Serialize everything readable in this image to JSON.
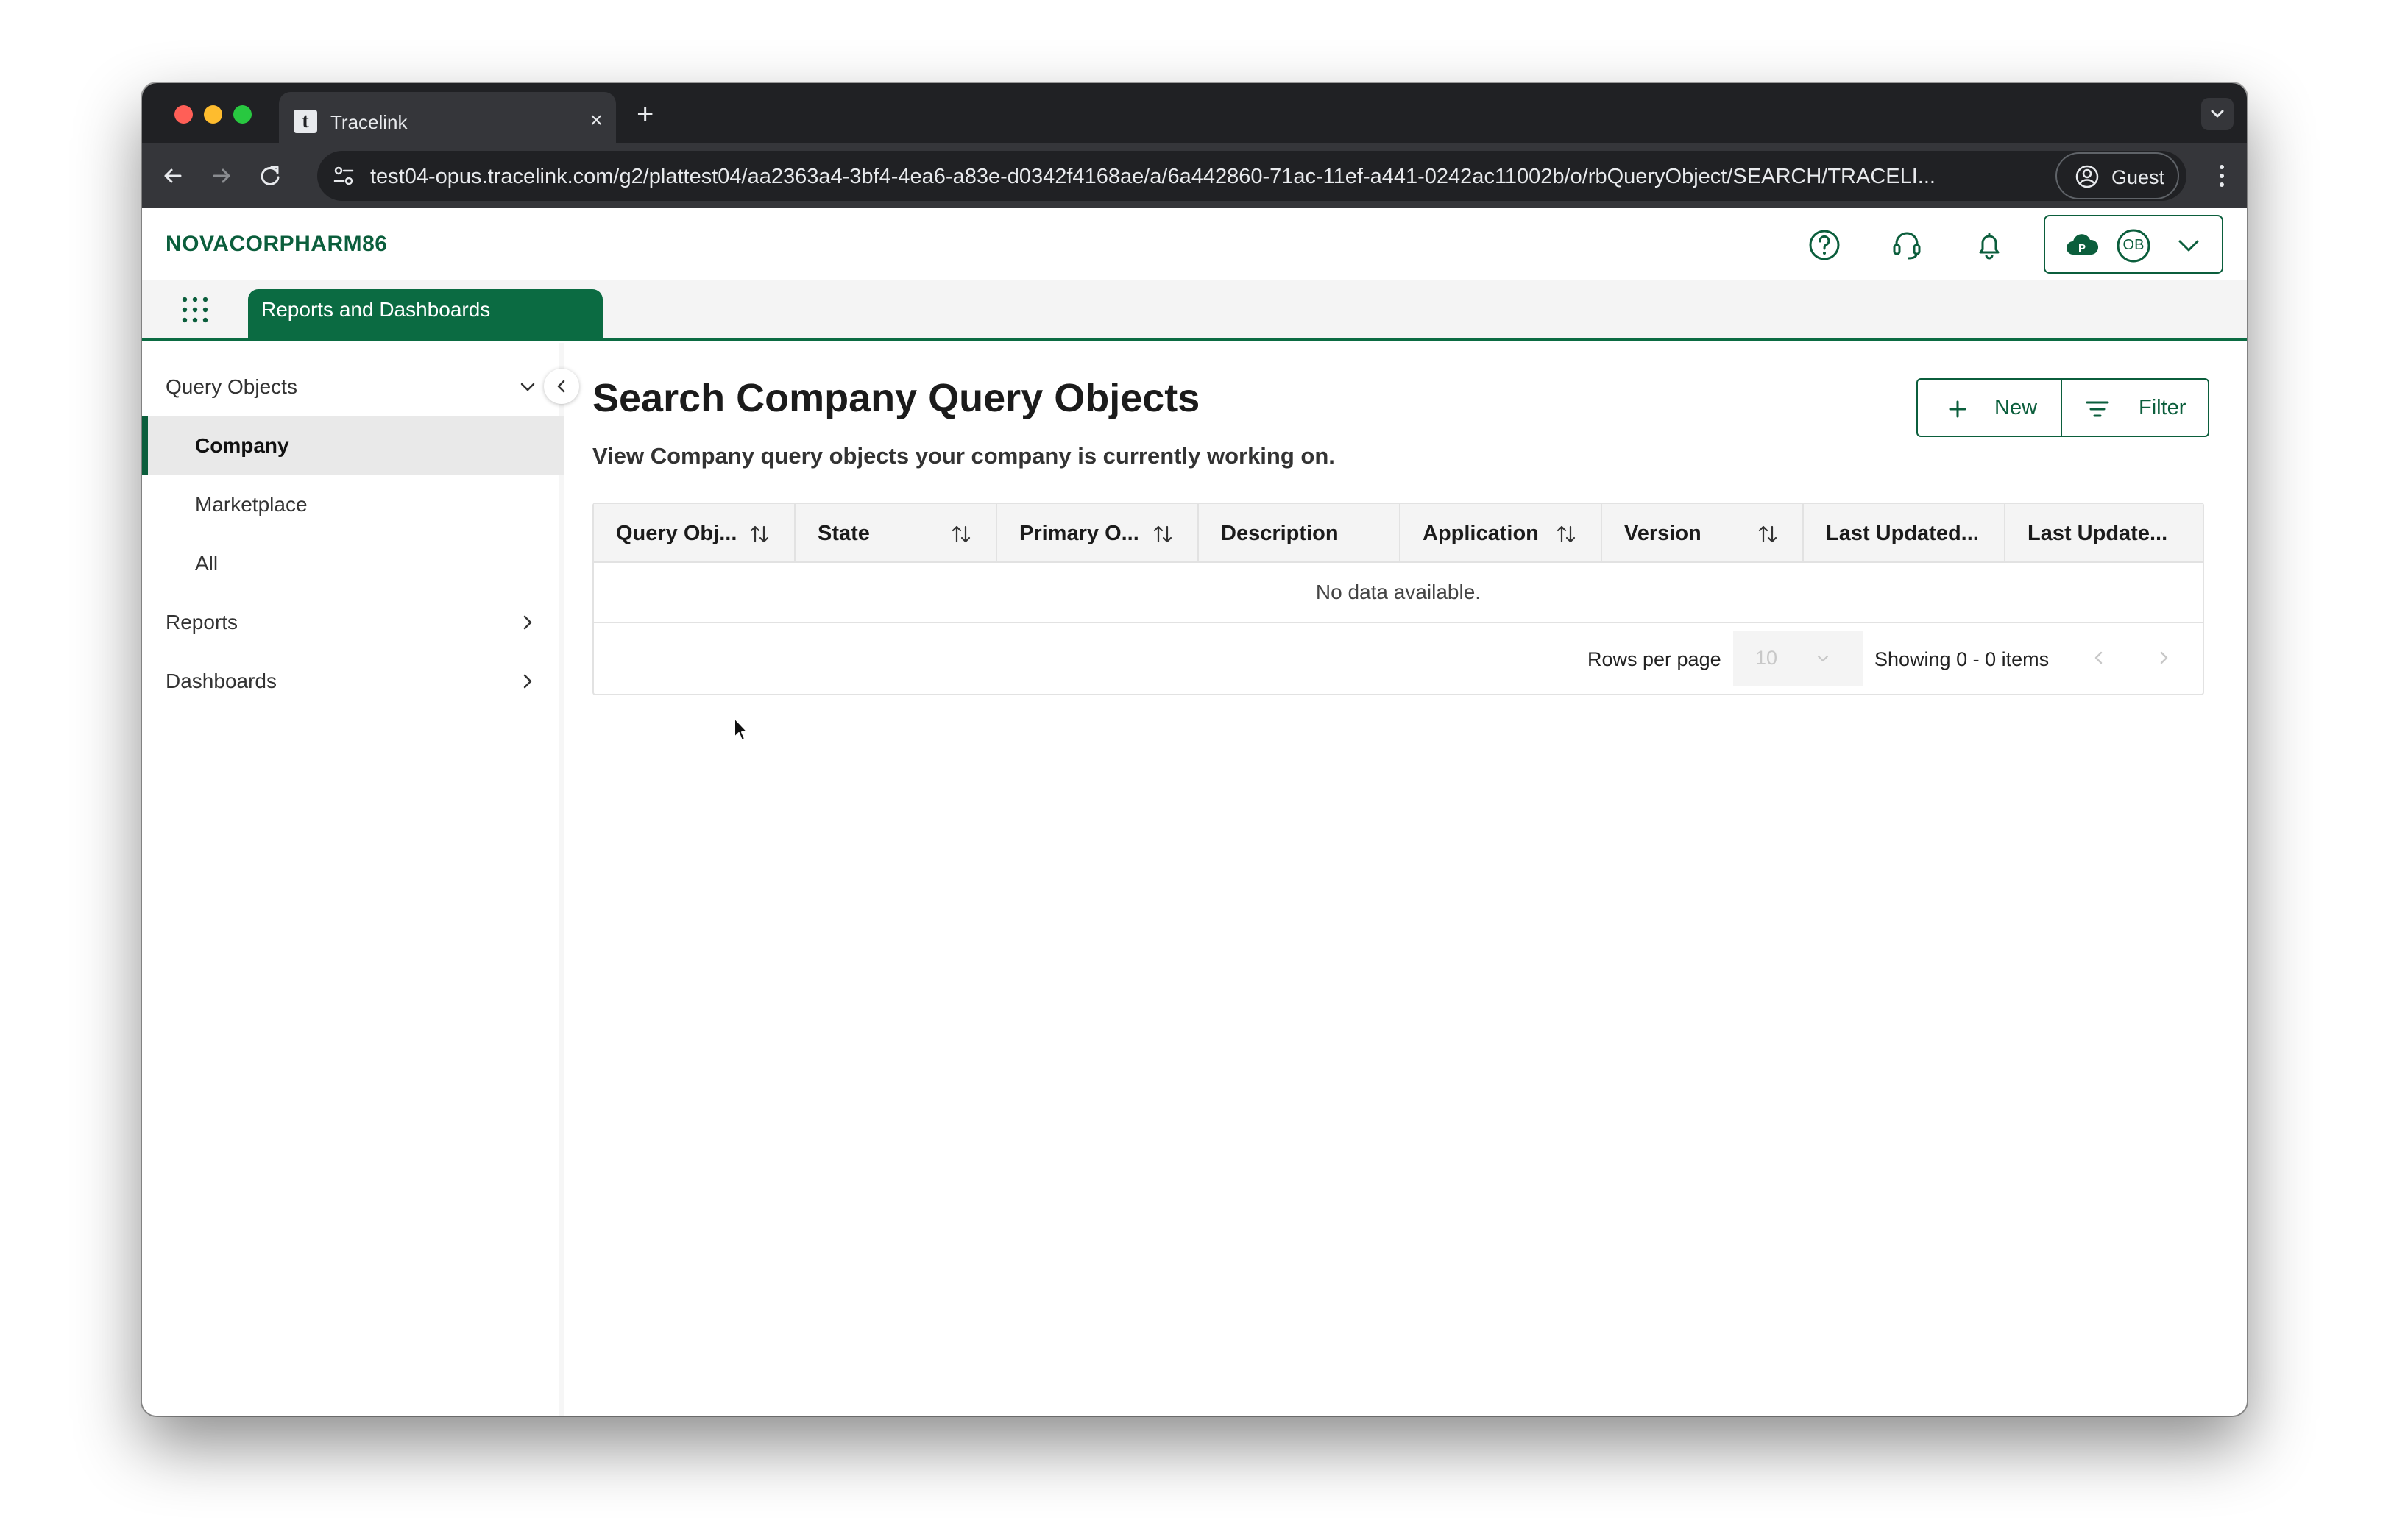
{
  "browser": {
    "tab_title": "Tracelink",
    "favicon_letter": "t",
    "new_tab_label": "+",
    "tab_close_label": "×",
    "url": "test04-opus.tracelink.com/g2/plattest04/aa2363a4-3bf4-4ea6-a83e-d0342f4168ae/a/6a442860-71ac-11ef-a441-0242ac11002b/o/rbQueryObject/SEARCH/TRACELI...",
    "profile_label": "Guest"
  },
  "header": {
    "brand": "NOVACORPHARM86",
    "account_initials": "OB"
  },
  "navbar": {
    "active_app": "Reports and Dashboards"
  },
  "sidebar": {
    "sections": [
      {
        "label": "Query Objects",
        "expanded": true
      },
      {
        "label": "Reports",
        "expanded": false
      },
      {
        "label": "Dashboards",
        "expanded": false
      }
    ],
    "query_object_items": [
      {
        "label": "Company",
        "active": true
      },
      {
        "label": "Marketplace",
        "active": false
      },
      {
        "label": "All",
        "active": false
      }
    ]
  },
  "main": {
    "title": "Search Company Query Objects",
    "description": "View Company query objects your company is currently working on.",
    "new_button": "New",
    "filter_button": "Filter"
  },
  "table": {
    "columns": [
      {
        "label": "Query Obj...",
        "sortable": true
      },
      {
        "label": "State",
        "sortable": true
      },
      {
        "label": "Primary O...",
        "sortable": true
      },
      {
        "label": "Description",
        "sortable": false
      },
      {
        "label": "Application",
        "sortable": true
      },
      {
        "label": "Version",
        "sortable": true
      },
      {
        "label": "Last Updated...",
        "sortable": false
      },
      {
        "label": "Last Update...",
        "sortable": false
      }
    ],
    "empty_message": "No data available.",
    "rows_per_page_label": "Rows per page",
    "rows_per_page_value": "10",
    "showing_text": "Showing 0 - 0 items"
  },
  "colors": {
    "brand_green": "#0b5e3c",
    "tab_green": "#0b6b42"
  }
}
